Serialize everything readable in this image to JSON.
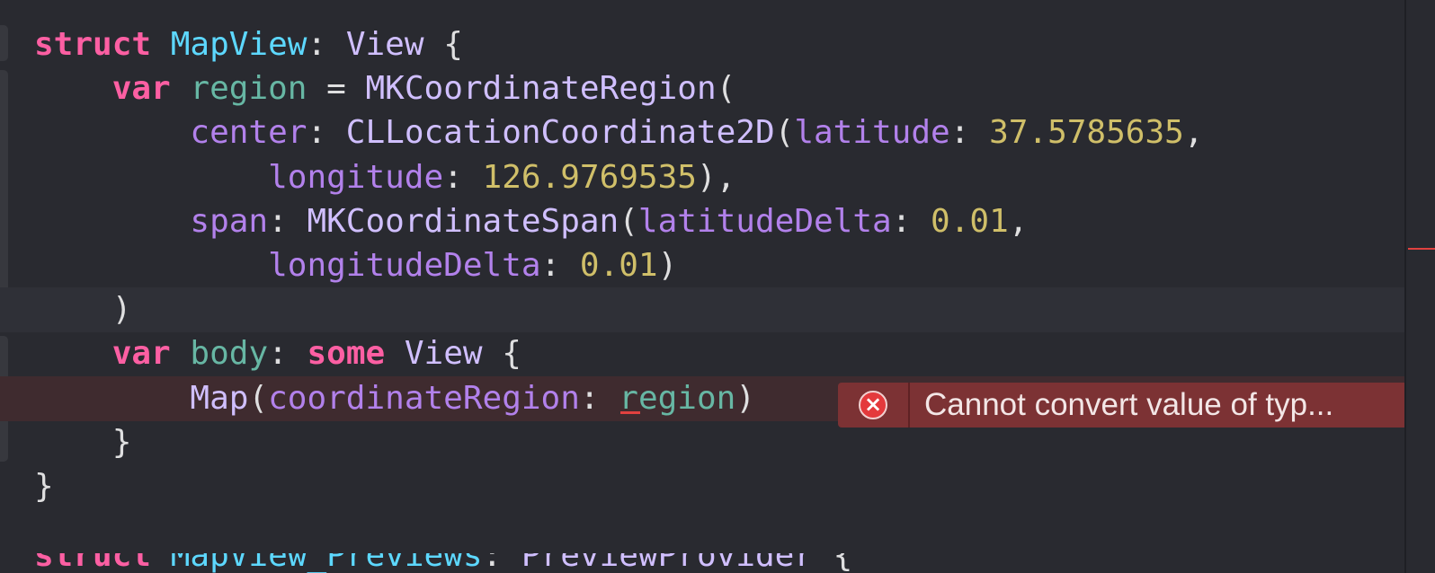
{
  "editor": {
    "lines": [
      {
        "tokens": [
          {
            "t": "struct",
            "c": "kw"
          },
          {
            "t": " ",
            "c": "plain"
          },
          {
            "t": "MapView",
            "c": "type-decl"
          },
          {
            "t": ": ",
            "c": "plain"
          },
          {
            "t": "View",
            "c": "type"
          },
          {
            "t": " {",
            "c": "plain"
          }
        ]
      },
      {
        "tokens": [
          {
            "t": "    ",
            "c": "plain"
          },
          {
            "t": "var",
            "c": "kw"
          },
          {
            "t": " ",
            "c": "plain"
          },
          {
            "t": "region",
            "c": "var-decl"
          },
          {
            "t": " = ",
            "c": "plain"
          },
          {
            "t": "MKCoordinateRegion",
            "c": "type"
          },
          {
            "t": "(",
            "c": "plain"
          }
        ]
      },
      {
        "tokens": [
          {
            "t": "        ",
            "c": "plain"
          },
          {
            "t": "center",
            "c": "param-soft"
          },
          {
            "t": ": ",
            "c": "plain"
          },
          {
            "t": "CLLocationCoordinate2D",
            "c": "type"
          },
          {
            "t": "(",
            "c": "plain"
          },
          {
            "t": "latitude",
            "c": "param-soft"
          },
          {
            "t": ": ",
            "c": "plain"
          },
          {
            "t": "37.5785635",
            "c": "num"
          },
          {
            "t": ",",
            "c": "plain"
          }
        ]
      },
      {
        "tokens": [
          {
            "t": "            ",
            "c": "plain"
          },
          {
            "t": "longitude",
            "c": "param-soft"
          },
          {
            "t": ": ",
            "c": "plain"
          },
          {
            "t": "126.9769535",
            "c": "num"
          },
          {
            "t": "),",
            "c": "plain"
          }
        ]
      },
      {
        "tokens": [
          {
            "t": "        ",
            "c": "plain"
          },
          {
            "t": "span",
            "c": "param-soft"
          },
          {
            "t": ": ",
            "c": "plain"
          },
          {
            "t": "MKCoordinateSpan",
            "c": "type"
          },
          {
            "t": "(",
            "c": "plain"
          },
          {
            "t": "latitudeDelta",
            "c": "param-soft"
          },
          {
            "t": ": ",
            "c": "plain"
          },
          {
            "t": "0.01",
            "c": "num"
          },
          {
            "t": ",",
            "c": "plain"
          }
        ]
      },
      {
        "tokens": [
          {
            "t": "            ",
            "c": "plain"
          },
          {
            "t": "longitudeDelta",
            "c": "param-soft"
          },
          {
            "t": ": ",
            "c": "plain"
          },
          {
            "t": "0.01",
            "c": "num"
          },
          {
            "t": ")",
            "c": "plain"
          }
        ]
      },
      {
        "tokens": [
          {
            "t": "    ",
            "c": "plain"
          },
          {
            "t": ")",
            "c": "plain"
          }
        ]
      },
      {
        "tokens": [
          {
            "t": "    ",
            "c": "plain"
          },
          {
            "t": "var",
            "c": "kw"
          },
          {
            "t": " ",
            "c": "plain"
          },
          {
            "t": "body",
            "c": "var-decl"
          },
          {
            "t": ": ",
            "c": "plain"
          },
          {
            "t": "some",
            "c": "kw"
          },
          {
            "t": " ",
            "c": "plain"
          },
          {
            "t": "View",
            "c": "type"
          },
          {
            "t": " {",
            "c": "plain"
          }
        ]
      },
      {
        "tokens": [
          {
            "t": "        ",
            "c": "plain"
          },
          {
            "t": "Map",
            "c": "type"
          },
          {
            "t": "(",
            "c": "plain"
          },
          {
            "t": "coordinateRegion",
            "c": "param-soft"
          },
          {
            "t": ": ",
            "c": "plain"
          },
          {
            "t": "region",
            "c": "region-ref",
            "err": true
          },
          {
            "t": ")",
            "c": "plain"
          }
        ]
      },
      {
        "tokens": [
          {
            "t": "    ",
            "c": "plain"
          },
          {
            "t": "}",
            "c": "plain"
          }
        ]
      },
      {
        "tokens": [
          {
            "t": "}",
            "c": "plain"
          }
        ]
      },
      {
        "tokens": []
      }
    ],
    "current_line_index": 6,
    "error_line_index": 8
  },
  "error": {
    "icon": "error-x-circle-icon",
    "message": "Cannot convert value of typ..."
  },
  "colors": {
    "background": "#292a30",
    "keyword": "#fc5fa3",
    "type_declaration": "#5dd8ff",
    "type": "#d0bfff",
    "variable": "#67b7a4",
    "parameter": "#b281eb",
    "number": "#d0bf69",
    "error_banner": "#7c3234",
    "error_icon": "#e4393c"
  }
}
